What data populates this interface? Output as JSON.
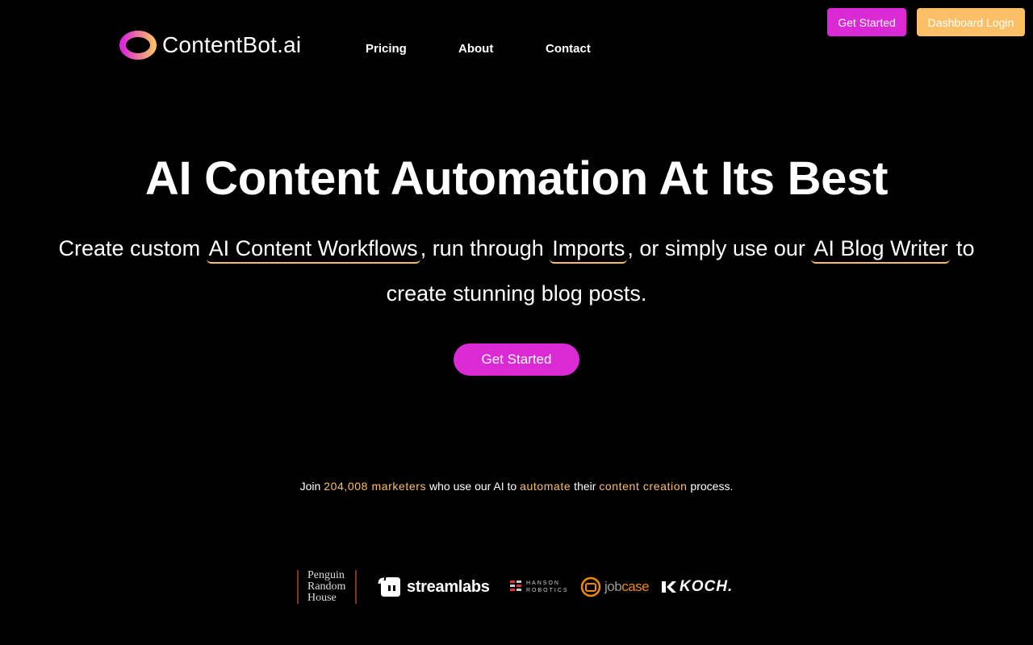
{
  "header": {
    "brand": "ContentBot.ai",
    "nav": [
      "Pricing",
      "About",
      "Contact"
    ],
    "get_started": "Get Started",
    "dashboard_login": "Dashboard Login"
  },
  "hero": {
    "headline": "AI Content Automation At Its Best",
    "sub_part1": "Create custom ",
    "sub_link1": "AI Content Workflows",
    "sub_part2": ", run through ",
    "sub_link2": "Imports",
    "sub_part3": ", or simply use our ",
    "sub_link3": "AI Blog Writer",
    "sub_part4": " to create stunning blog posts.",
    "cta": "Get Started"
  },
  "social_proof": {
    "join": "Join ",
    "count": "204,008 marketers",
    "mid1": " who use our AI to ",
    "automate": "automate",
    "mid2": " their ",
    "content_creation": "content creation",
    "end": " process."
  },
  "logos": {
    "penguin": [
      "Penguin",
      "Random",
      "House"
    ],
    "streamlabs": "streamlabs",
    "hanson": [
      "HANSON",
      "ROBOTICS"
    ],
    "jobcase_job": "job",
    "jobcase_case": "case",
    "koch": "KOCH."
  },
  "colors": {
    "accent_pink": "#d92ad6",
    "accent_orange": "#fbbf68",
    "background": "#000000"
  }
}
